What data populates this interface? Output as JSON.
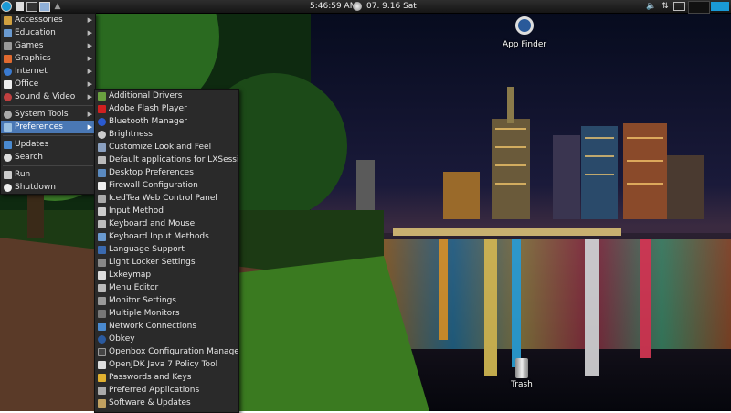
{
  "panel": {
    "clock": "5:46:59 AM",
    "date": "07. 9.16 Sat"
  },
  "desktop": {
    "app_finder": "App Finder",
    "trash": "Trash"
  },
  "main_menu": {
    "items": [
      {
        "label": "Accessories",
        "icon": "accessories-icon",
        "submenu": true
      },
      {
        "label": "Education",
        "icon": "education-icon",
        "submenu": true
      },
      {
        "label": "Games",
        "icon": "games-icon",
        "submenu": true
      },
      {
        "label": "Graphics",
        "icon": "graphics-icon",
        "submenu": true
      },
      {
        "label": "Internet",
        "icon": "internet-icon",
        "submenu": true
      },
      {
        "label": "Office",
        "icon": "office-icon",
        "submenu": true
      },
      {
        "label": "Sound & Video",
        "icon": "sound-video-icon",
        "submenu": true
      },
      {
        "label": "System Tools",
        "icon": "system-tools-icon",
        "submenu": true
      },
      {
        "label": "Preferences",
        "icon": "preferences-icon",
        "submenu": true,
        "selected": true
      },
      {
        "label": "Updates",
        "icon": "updates-icon",
        "submenu": false
      },
      {
        "label": "Search",
        "icon": "search-icon",
        "submenu": false
      },
      {
        "label": "Run",
        "icon": "run-icon",
        "submenu": false
      },
      {
        "label": "Shutdown",
        "icon": "shutdown-icon",
        "submenu": false
      }
    ]
  },
  "preferences_menu": {
    "items": [
      {
        "label": "Additional Drivers",
        "icon": "drivers-icon"
      },
      {
        "label": "Adobe Flash Player",
        "icon": "flash-icon"
      },
      {
        "label": "Bluetooth Manager",
        "icon": "bluetooth-icon"
      },
      {
        "label": "Brightness",
        "icon": "brightness-icon"
      },
      {
        "label": "Customize Look and Feel",
        "icon": "appearance-icon"
      },
      {
        "label": "Default applications for LXSession",
        "icon": "default-apps-icon"
      },
      {
        "label": "Desktop Preferences",
        "icon": "desktop-icon"
      },
      {
        "label": "Firewall Configuration",
        "icon": "firewall-icon"
      },
      {
        "label": "IcedTea Web Control Panel",
        "icon": "icedtea-icon"
      },
      {
        "label": "Input Method",
        "icon": "input-method-icon"
      },
      {
        "label": "Keyboard and Mouse",
        "icon": "keyboard-icon"
      },
      {
        "label": "Keyboard Input Methods",
        "icon": "keyboard-input-icon"
      },
      {
        "label": "Language Support",
        "icon": "language-icon"
      },
      {
        "label": "Light Locker Settings",
        "icon": "lock-icon"
      },
      {
        "label": "Lxkeymap",
        "icon": "keymap-icon"
      },
      {
        "label": "Menu Editor",
        "icon": "menu-editor-icon"
      },
      {
        "label": "Monitor Settings",
        "icon": "monitor-icon"
      },
      {
        "label": "Multiple Monitors",
        "icon": "monitors-icon"
      },
      {
        "label": "Network Connections",
        "icon": "network-icon"
      },
      {
        "label": "Obkey",
        "icon": "obkey-icon"
      },
      {
        "label": "Openbox Configuration Manager",
        "icon": "openbox-icon"
      },
      {
        "label": "OpenJDK Java 7 Policy Tool",
        "icon": "java-icon"
      },
      {
        "label": "Passwords and Keys",
        "icon": "keys-icon"
      },
      {
        "label": "Preferred Applications",
        "icon": "preferred-apps-icon"
      },
      {
        "label": "Software & Updates",
        "icon": "software-icon"
      }
    ]
  },
  "colors": {
    "selection": "#4a78b5",
    "menu_bg": "#2a2a2a",
    "panel_bg": "#1e1e1e"
  }
}
